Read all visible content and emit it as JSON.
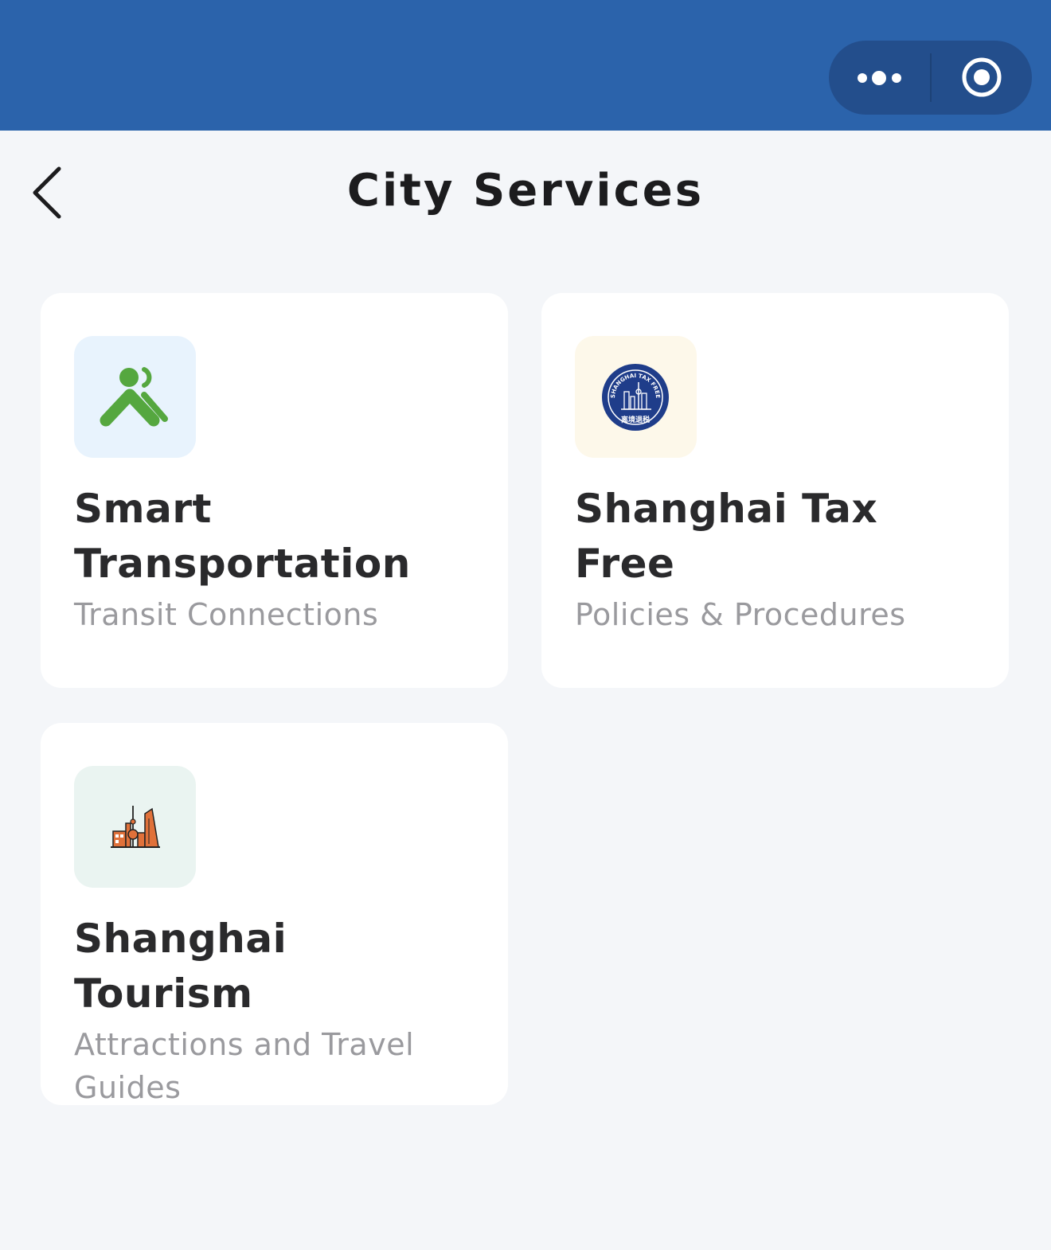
{
  "header": {
    "title": "City Services"
  },
  "capsule": {
    "more_icon": "more-dots-icon",
    "close_icon": "target-circle-icon"
  },
  "cards": [
    {
      "title": "Smart Transportation",
      "subtitle": "Transit Connections",
      "icon": "transit-people-icon",
      "tile_color": "#e8f3fd",
      "icon_color": "#55a73f"
    },
    {
      "title": "Shanghai Tax Free",
      "subtitle": "Policies & Procedures",
      "icon": "tax-free-seal-icon",
      "tile_color": "#fdf8ea",
      "icon_color": "#1f3d8a",
      "seal_text": "SHANGHAI TAX FREE",
      "seal_bottom_text": "离境退税"
    },
    {
      "title": "Shanghai Tourism",
      "subtitle": "Attractions and Travel Guides",
      "icon": "skyline-icon",
      "tile_color": "#eaf4f1",
      "icon_color": "#e0713a"
    }
  ],
  "colors": {
    "top_bar": "#2b63ab",
    "capsule": "#234e8c",
    "background": "#f4f6f9"
  }
}
